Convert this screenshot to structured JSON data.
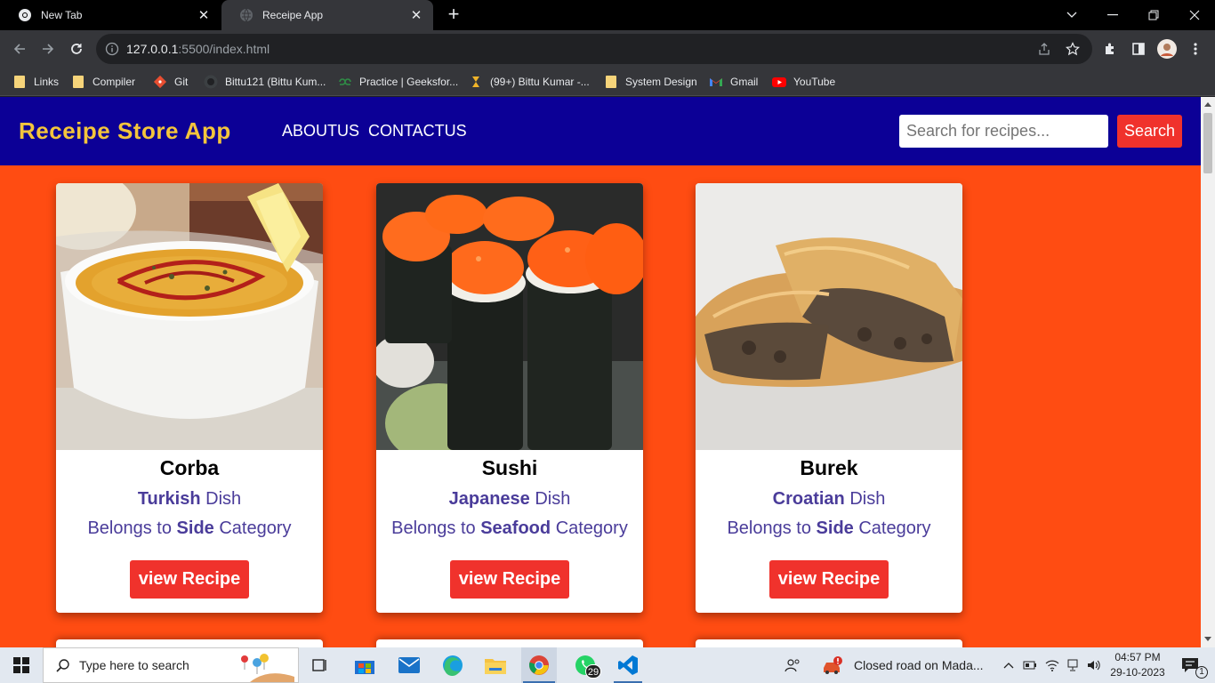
{
  "browser": {
    "tabs": [
      {
        "title": "New Tab",
        "active": false
      },
      {
        "title": "Receipe App",
        "active": true
      }
    ],
    "url_host": "127.0.0.1",
    "url_rest": ":5500/index.html",
    "bookmarks": [
      "Links",
      "Compiler",
      "Git",
      "Bittu121 (Bittu Kum...",
      "Practice | Geeksfor...",
      "(99+) Bittu Kumar -...",
      "System Design",
      "Gmail",
      "YouTube"
    ]
  },
  "app": {
    "brand": "Receipe Store App",
    "nav": [
      "ABOUTUS",
      "CONTACTUS"
    ],
    "search_placeholder": "Search for recipes...",
    "search_button": "Search",
    "belongs_prefix": "Belongs to",
    "category_suffix": "Category",
    "dish_suffix": "Dish",
    "view_button": "view Recipe",
    "recipes": [
      {
        "name": "Corba",
        "area": "Turkish",
        "category": "Side"
      },
      {
        "name": "Sushi",
        "area": "Japanese",
        "category": "Seafood"
      },
      {
        "name": "Burek",
        "area": "Croatian",
        "category": "Side"
      }
    ]
  },
  "taskbar": {
    "search_placeholder": "Type here to search",
    "whatsapp_badge": "29",
    "news_text": "Closed road on Mada...",
    "time": "04:57 PM",
    "date": "29-10-2023",
    "notification_count": "1"
  },
  "colors": {
    "page_bg": "#ff4c12",
    "nav_bg": "#0c0096",
    "brand": "#f3c53c",
    "accent_button": "#f0322c",
    "card_text": "#4a3c9a"
  }
}
